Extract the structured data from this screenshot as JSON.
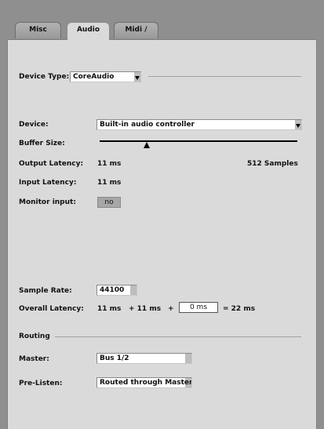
{
  "tabs": [
    {
      "label": "Misc",
      "active": false
    },
    {
      "label": "Audio",
      "active": true
    },
    {
      "label": "Midi / Sync",
      "active": false
    }
  ],
  "device_type": {
    "label": "Device Type:",
    "value": "CoreAudio"
  },
  "device": {
    "label": "Device:",
    "value": "Built-in audio controller"
  },
  "buffer_size": {
    "label": "Buffer Size:",
    "level": 0.24
  },
  "output_latency": {
    "label": "Output Latency:",
    "value": "11 ms",
    "samples": "512 Samples"
  },
  "input_latency": {
    "label": "Input Latency:",
    "value": "11 ms"
  },
  "monitor_input": {
    "label": "Monitor input:",
    "value": "no"
  },
  "sample_rate": {
    "label": "Sample Rate:",
    "value": "44100"
  },
  "overall_latency": {
    "label": "Overall Latency:",
    "part1": "11 ms",
    "part2": "+ 11 ms",
    "plus": "+",
    "extra_value": "0 ms",
    "total": "= 22 ms"
  },
  "routing": {
    "heading": "Routing",
    "master": {
      "label": "Master:",
      "value": "Bus 1/2"
    },
    "pre_listen": {
      "label": "Pre-Listen:",
      "value": "Routed through Master"
    }
  },
  "colors": {
    "panel": "#dadada",
    "frame": "#8f8f8f"
  }
}
